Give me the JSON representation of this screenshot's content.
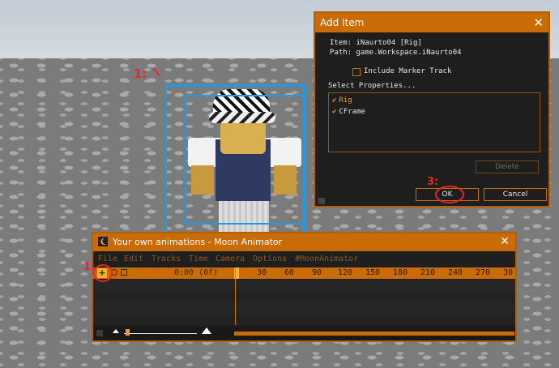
{
  "dialog": {
    "title": "Add Item",
    "close": "✕",
    "item_label": "Item:",
    "item_value": "iNaurto04 [Rig]",
    "path_label": "Path:",
    "path_value": "game.Workspace.iNaurto04",
    "marker_track_label": "Include Marker Track",
    "select_properties_label": "Select Properties...",
    "properties": [
      {
        "label": "Rig",
        "checked": true
      },
      {
        "label": "CFrame",
        "checked": true
      }
    ],
    "delete_label": "Delete",
    "ok_label": "OK",
    "cancel_label": "Cancel"
  },
  "annotations": {
    "one": "1:",
    "two": "2:",
    "three": "3:"
  },
  "moon": {
    "title": "Your own animations - Moon Animator",
    "close": "✕",
    "menu": [
      "File",
      "Edit",
      "Tracks",
      "Time",
      "Camera",
      "Options",
      "#MoonAnimator"
    ],
    "timecode": "0:00 (0f)",
    "ticks": [
      "30",
      "60",
      "90",
      "120",
      "150",
      "180",
      "210",
      "240",
      "270",
      "30"
    ],
    "add_track_symbol": "+"
  },
  "colors": {
    "accent": "#c96b06",
    "accent_light": "#f09a2a",
    "panel_bg": "#1e1e1e",
    "selection": "#1e9be6",
    "annotation": "#e5262a"
  }
}
